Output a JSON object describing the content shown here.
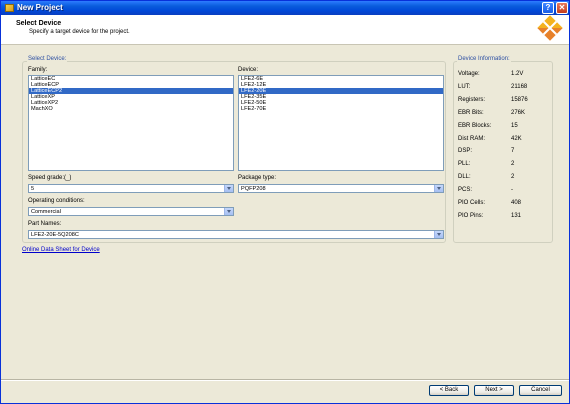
{
  "window": {
    "title": "New Project"
  },
  "header": {
    "title": "Select Device",
    "subtitle": "Specify a target device for the project."
  },
  "select_device": {
    "group_label": "Select Device:",
    "family": {
      "label": "Family:",
      "items": [
        "LatticeEC",
        "LatticeECP",
        "LatticeECP2",
        "LatticeXP",
        "LatticeXP2",
        "MachXO"
      ],
      "selected_index": 2
    },
    "device": {
      "label": "Device:",
      "items": [
        "LFE2-6E",
        "LFE2-12E",
        "LFE2-20E",
        "LFE2-35E",
        "LFE2-50E",
        "LFE2-70E"
      ],
      "selected_index": 2
    },
    "speed_grade": {
      "label": "Speed grade:(_)",
      "value": "5"
    },
    "package_type": {
      "label": "Package type:",
      "value": "PQFP208"
    },
    "operating_conditions": {
      "label": "Operating conditions:",
      "value": "Commercial"
    },
    "part_names": {
      "label": "Part Names:",
      "value": "LFE2-20E-5Q208C"
    }
  },
  "link": {
    "label": "Online Data Sheet for Device"
  },
  "device_info": {
    "group_label": "Device Information:",
    "rows": [
      {
        "key": "Voltage:",
        "value": "1.2V"
      },
      {
        "key": "LUT:",
        "value": "21168"
      },
      {
        "key": "Registers:",
        "value": "15876"
      },
      {
        "key": "EBR Bits:",
        "value": "276K"
      },
      {
        "key": "EBR Blocks:",
        "value": "15"
      },
      {
        "key": "Dist RAM:",
        "value": "42K"
      },
      {
        "key": "DSP:",
        "value": "7"
      },
      {
        "key": "PLL:",
        "value": "2"
      },
      {
        "key": "DLL:",
        "value": "2"
      },
      {
        "key": "PCS:",
        "value": "-"
      },
      {
        "key": "PIO Cells:",
        "value": "408"
      },
      {
        "key": "PIO Pins:",
        "value": "131"
      }
    ]
  },
  "buttons": {
    "back": "< Back",
    "next": "Next >",
    "cancel": "Cancel"
  },
  "colors": {
    "titlebar": "#0a5ddd",
    "selection": "#3169c6",
    "group_label": "#2c4fa3",
    "dialog_bg": "#ece9d8"
  }
}
